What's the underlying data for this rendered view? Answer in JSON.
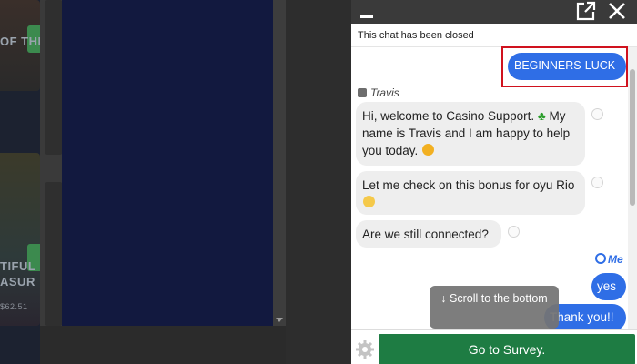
{
  "background": {
    "tile_texts": [
      "OF THE",
      "TIFUL",
      "ASUR",
      "$62.51"
    ]
  },
  "chat": {
    "header": {
      "minimize_icon": "minimize-icon",
      "popout_icon": "external-link-icon",
      "close_icon": "close-icon"
    },
    "notice": "This chat has been closed",
    "messages": {
      "promo_code": "BEGINNERS-LUCK",
      "agent_name": "Travis",
      "agent_msg1_line1": "Hi, welcome to Casino Support.",
      "agent_msg1_rest": "My name is Travis and I am happy to help you today.",
      "agent_msg2": "Let me check on this bonus for oyu Rio",
      "agent_msg3": "Are we still connected?",
      "me_label": "Me",
      "user_msg_yes": "yes",
      "user_msg_thanks": "Thank you!!"
    },
    "scroll_button": "↓ Scroll to the bottom",
    "footer": {
      "settings_icon": "gear-icon",
      "survey_label": "Go to Survey."
    }
  },
  "colors": {
    "user_bubble": "#2f6ee6",
    "agent_bubble": "#eeeeee",
    "survey_button": "#1e7c43",
    "highlight_border": "#d0121e",
    "header": "#3a3a3a"
  }
}
